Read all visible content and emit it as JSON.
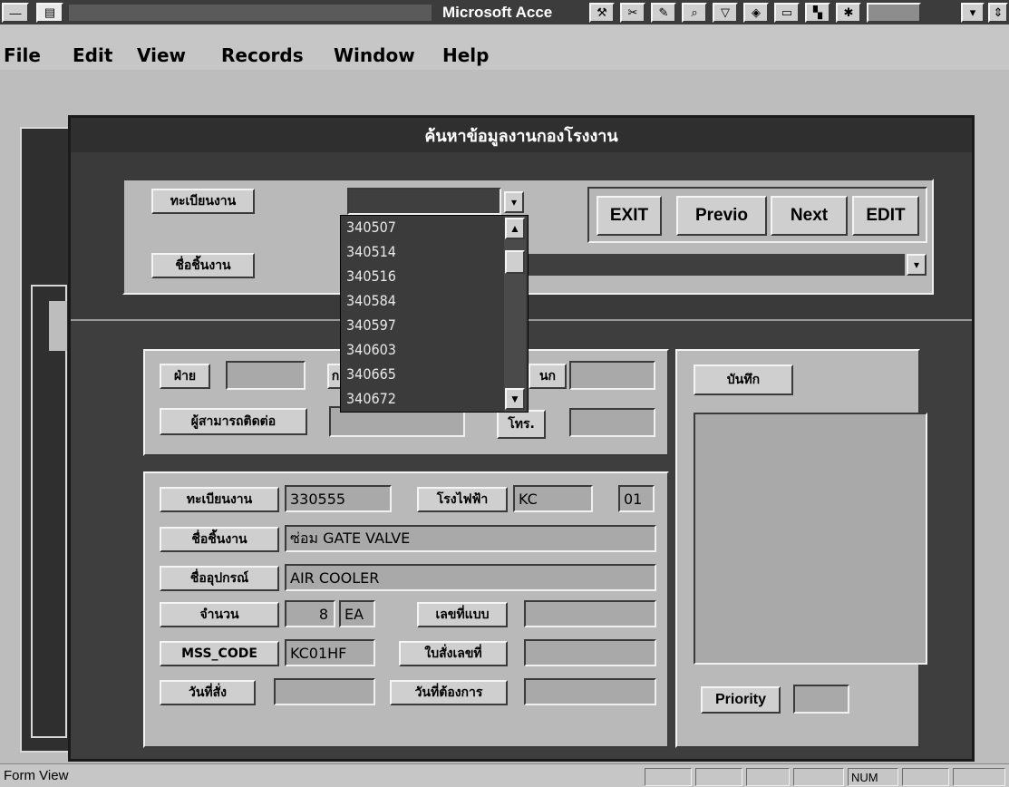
{
  "app": {
    "window_title": "Microsoft Acce",
    "sys_menu_icon": "minimize-icon",
    "doc_icon": "document-icon"
  },
  "menu": [
    "File",
    "Edit",
    "View",
    "Records",
    "Window",
    "Help"
  ],
  "dialog": {
    "title": "ค้นหาข้อมูลงานกองโรงงาน",
    "search": {
      "reg_label": "ทะเบียนงาน",
      "reg_value": "",
      "name_label": "ชื่อชิ้นงาน",
      "name_value": ""
    },
    "nav_buttons": {
      "exit": "EXIT",
      "previous": "Previo",
      "next": "Next",
      "edit": "EDIT"
    },
    "dropdown_items": [
      "340507",
      "340514",
      "340516",
      "340584",
      "340597",
      "340603",
      "340665",
      "340672"
    ],
    "contact": {
      "dept_label": "ฝ่าย",
      "dept_value": "",
      "mid_label": "ก",
      "mid_value": "",
      "right_label": "นก",
      "right_value": "",
      "contact_label": "ผู้สามารถติดต่อ",
      "contact_value": "",
      "phone_label": "โทร.",
      "phone_value": ""
    },
    "details": {
      "reg_label": "ทะเบียนงาน",
      "reg_value": "330555",
      "plant_label": "โรงไฟฟ้า",
      "plant_value": "KC",
      "plant_code": "01",
      "item_label": "ชื่อชิ้นงาน",
      "item_value": "ซ่อม GATE VALVE",
      "equip_label": "ชื่ออุปกรณ์",
      "equip_value": "AIR COOLER",
      "qty_label": "จำนวน",
      "qty_value": "8",
      "unit_value": "EA",
      "drawing_label": "เลขที่แบบ",
      "drawing_value": "",
      "mss_label": "MSS_CODE",
      "mss_value": "KC01HF",
      "order_label": "ใบสั่งเลขที่",
      "order_value": "",
      "orderdate_label": "วันที่สั่ง",
      "orderdate_value": "",
      "needdate_label": "วันที่ต้องการ",
      "needdate_value": ""
    },
    "notes": {
      "label": "บันทึก",
      "value": "",
      "priority_label": "Priority",
      "priority_value": ""
    }
  },
  "status": {
    "mode": "Form View",
    "num": "NUM"
  }
}
